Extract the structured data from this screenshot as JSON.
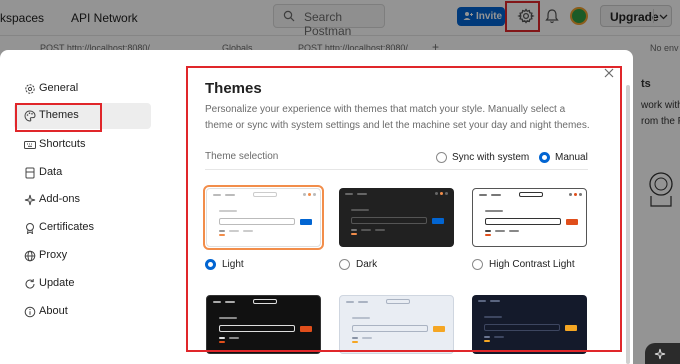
{
  "topbar": {
    "workspaces_label": "kspaces",
    "api_network_label": "API Network",
    "search_placeholder": "Search Postman",
    "invite_label": "Invite",
    "upgrade_label": "Upgrade",
    "colors": {
      "accent": "#0265d2",
      "highlight": "#e0262a"
    }
  },
  "tabs": {
    "tab1": "POST http://localhost:8080/",
    "tab2": "Globals",
    "tab3": "POST http://localhost:8080/",
    "add": "+",
    "env": "No env"
  },
  "right_panel": {
    "line1": "ts",
    "line2": "work with th",
    "line3": "rom the Pu"
  },
  "sidebar": {
    "items": [
      {
        "label": "General",
        "icon": "gear-icon"
      },
      {
        "label": "Themes",
        "icon": "palette-icon",
        "active": true
      },
      {
        "label": "Shortcuts",
        "icon": "keyboard-icon"
      },
      {
        "label": "Data",
        "icon": "database-icon"
      },
      {
        "label": "Add-ons",
        "icon": "sparkle-icon"
      },
      {
        "label": "Certificates",
        "icon": "certificate-icon"
      },
      {
        "label": "Proxy",
        "icon": "proxy-icon"
      },
      {
        "label": "Update",
        "icon": "update-icon"
      },
      {
        "label": "About",
        "icon": "info-icon"
      }
    ]
  },
  "themes": {
    "title": "Themes",
    "description": "Personalize your experience with themes that match your style. Manually select a theme or sync with system settings and let the machine set your day and night themes.",
    "selection_label": "Theme selection",
    "sync_label": "Sync with system",
    "manual_label": "Manual",
    "mode": "Manual",
    "options": [
      {
        "label": "Light",
        "selected": true,
        "bg": "#ffffff",
        "accent": "#0265d2"
      },
      {
        "label": "Dark",
        "selected": false,
        "bg": "#212121",
        "accent": "#0265d2"
      },
      {
        "label": "High Contrast Light",
        "selected": false,
        "bg": "#ffffff",
        "accent": "#e04e1b"
      },
      {
        "label": "",
        "selected": false,
        "bg": "#111111",
        "accent": "#e04e1b"
      },
      {
        "label": "",
        "selected": false,
        "bg": "#e9edf3",
        "accent": "#f5a623"
      },
      {
        "label": "",
        "selected": false,
        "bg": "#141a2b",
        "accent": "#f5a623"
      }
    ]
  }
}
